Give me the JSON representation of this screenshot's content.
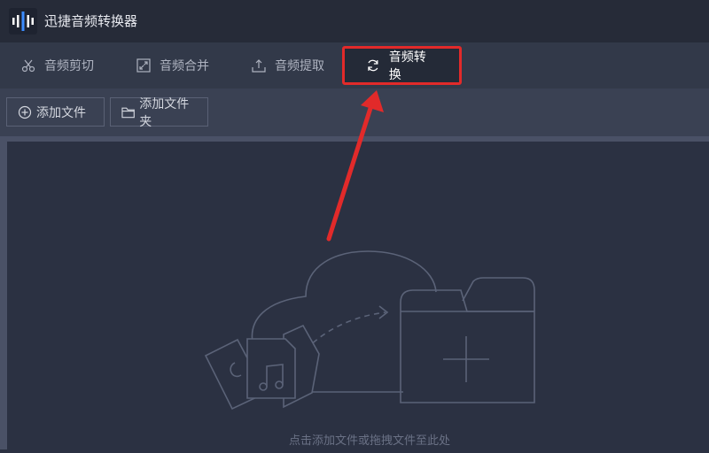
{
  "app": {
    "title": "迅捷音频转换器",
    "logo_icon": "waveform-logo-icon"
  },
  "tabs": [
    {
      "label": "音频剪切",
      "icon": "scissors-icon",
      "active": false
    },
    {
      "label": "音频合并",
      "icon": "merge-icon",
      "active": false
    },
    {
      "label": "音频提取",
      "icon": "upload-extract-icon",
      "active": false
    },
    {
      "label": "音频转换",
      "icon": "refresh-convert-icon",
      "active": true
    }
  ],
  "toolbar": {
    "add_file_label": "添加文件",
    "add_folder_label": "添加文件夹"
  },
  "dropzone": {
    "hint": "点击添加文件或拖拽文件至此处"
  },
  "colors": {
    "highlight": "#e22a2a",
    "arrow": "#e22a2a",
    "background": "#2b3142"
  }
}
